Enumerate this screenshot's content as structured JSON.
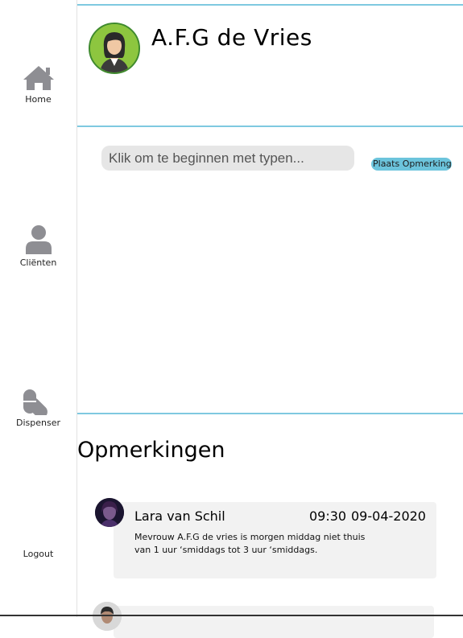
{
  "sidebar": {
    "items": [
      {
        "label": "Home",
        "icon": "home-icon"
      },
      {
        "label": "Cliënten",
        "icon": "user-icon"
      },
      {
        "label": "Dispenser",
        "icon": "pills-icon"
      },
      {
        "label": "Logout"
      }
    ]
  },
  "client": {
    "name": "A.F.G de Vries",
    "avatar": "female-avatar"
  },
  "composer": {
    "placeholder": "Klik om te beginnen met typen...",
    "submit_label": "Plaats Opmerking"
  },
  "comments": {
    "title": "Opmerkingen",
    "items": [
      {
        "author": "Lara van Schil",
        "time": "09:30",
        "date": "09-04-2020",
        "body": "Mevrouw A.F.G de vries is morgen middag niet thuis van 1 uur ‘smiddags tot 3 uur ‘smiddags."
      },
      {
        "author": "",
        "time": "",
        "date": "",
        "body": ""
      }
    ]
  },
  "colors": {
    "accent": "#7fc9e0",
    "button": "#6cc4dc",
    "icon": "#8e8e93",
    "card": "#f2f2f2"
  }
}
